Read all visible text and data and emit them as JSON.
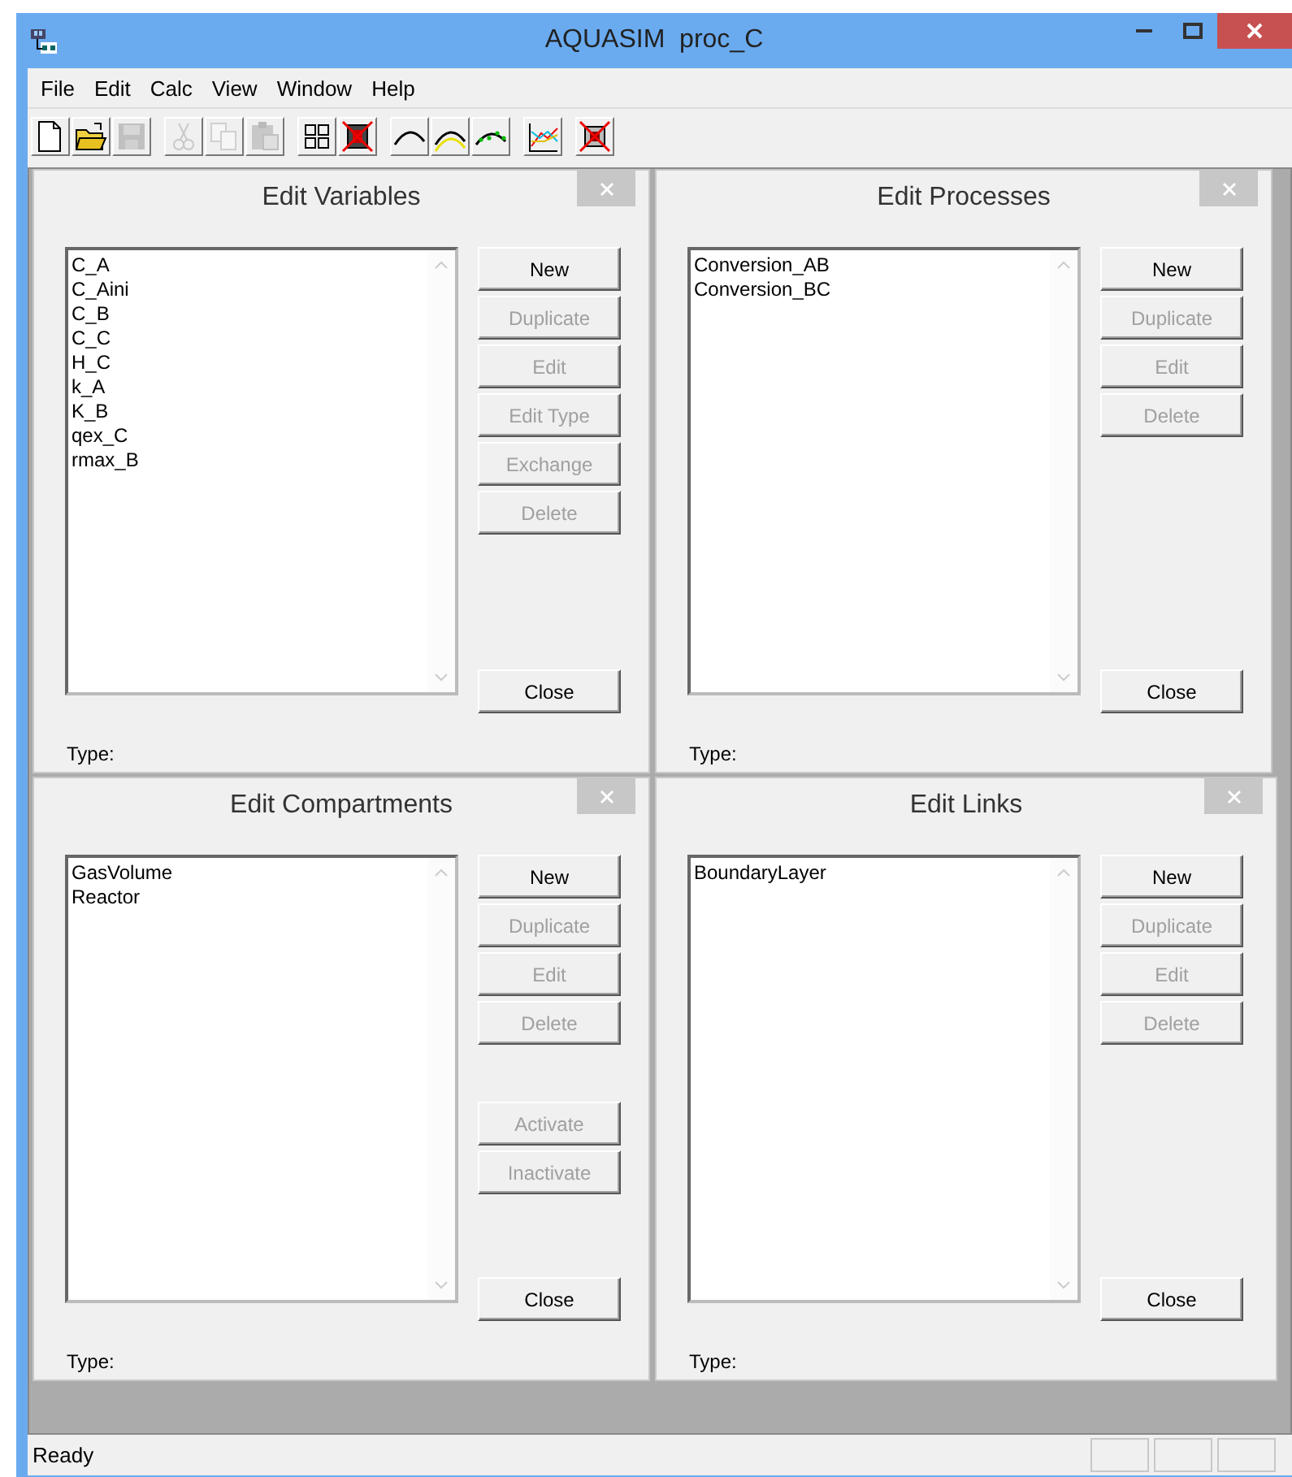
{
  "window": {
    "title": "AQUASIM  proc_C"
  },
  "menu": [
    "File",
    "Edit",
    "Calc",
    "View",
    "Window",
    "Help"
  ],
  "toolbar": [
    [
      {
        "kind": "new",
        "disabled": false
      },
      {
        "kind": "open",
        "disabled": false
      },
      {
        "kind": "save",
        "disabled": true
      }
    ],
    [
      {
        "kind": "cut",
        "disabled": true
      },
      {
        "kind": "copy",
        "disabled": true
      },
      {
        "kind": "paste",
        "disabled": true
      }
    ],
    [
      {
        "kind": "grid",
        "disabled": false
      },
      {
        "kind": "cancel",
        "disabled": false
      }
    ],
    [
      {
        "kind": "curve",
        "disabled": false
      },
      {
        "kind": "curve2",
        "disabled": false
      },
      {
        "kind": "curve3",
        "disabled": false
      }
    ],
    [
      {
        "kind": "plot",
        "disabled": false
      }
    ],
    [
      {
        "kind": "stop",
        "disabled": false
      }
    ]
  ],
  "panels": [
    {
      "title": "Edit Variables",
      "items": [
        "C_A",
        "C_Aini",
        "C_B",
        "C_C",
        "H_C",
        "k_A",
        "K_B",
        "qex_C",
        "rmax_B"
      ],
      "buttons": [
        {
          "label": "New",
          "disabled": false
        },
        {
          "label": "Duplicate",
          "disabled": true
        },
        {
          "label": "Edit",
          "disabled": true
        },
        {
          "label": "Edit Type",
          "disabled": true
        },
        {
          "label": "Exchange",
          "disabled": true
        },
        {
          "label": "Delete",
          "disabled": true
        }
      ],
      "close": "Close",
      "type_label": "Type:"
    },
    {
      "title": "Edit Processes",
      "items": [
        "Conversion_AB",
        "Conversion_BC"
      ],
      "buttons": [
        {
          "label": "New",
          "disabled": false
        },
        {
          "label": "Duplicate",
          "disabled": true
        },
        {
          "label": "Edit",
          "disabled": true
        },
        {
          "label": "Delete",
          "disabled": true
        }
      ],
      "close": "Close",
      "type_label": "Type:"
    },
    {
      "title": "Edit Compartments",
      "items": [
        "GasVolume",
        "Reactor"
      ],
      "buttons": [
        {
          "label": "New",
          "disabled": false
        },
        {
          "label": "Duplicate",
          "disabled": true
        },
        {
          "label": "Edit",
          "disabled": true
        },
        {
          "label": "Delete",
          "disabled": true
        }
      ],
      "extra_buttons": [
        {
          "label": "Activate",
          "disabled": true
        },
        {
          "label": "Inactivate",
          "disabled": true
        }
      ],
      "close": "Close",
      "type_label": "Type:"
    },
    {
      "title": "Edit Links",
      "items": [
        "BoundaryLayer"
      ],
      "buttons": [
        {
          "label": "New",
          "disabled": false
        },
        {
          "label": "Duplicate",
          "disabled": true
        },
        {
          "label": "Edit",
          "disabled": true
        },
        {
          "label": "Delete",
          "disabled": true
        }
      ],
      "close": "Close",
      "type_label": "Type:"
    }
  ],
  "status_bar": {
    "text": "Ready"
  }
}
